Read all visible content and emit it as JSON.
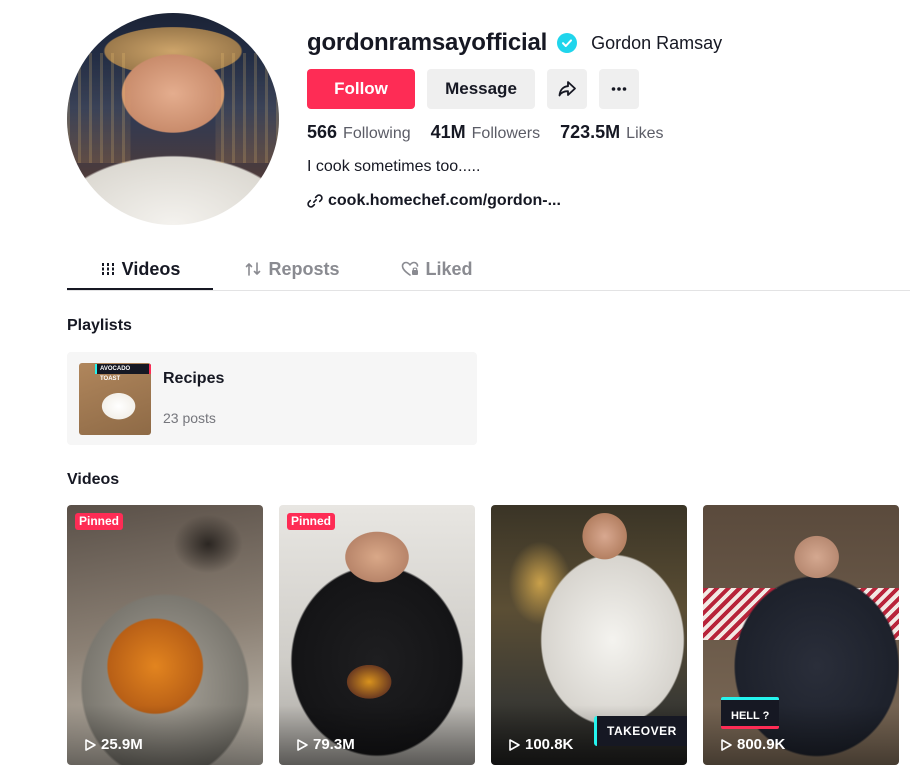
{
  "profile": {
    "username": "gordonramsayofficial",
    "display_name": "Gordon Ramsay",
    "verified": true,
    "follow_label": "Follow",
    "message_label": "Message",
    "stats": [
      {
        "value": "566",
        "label": "Following"
      },
      {
        "value": "41M",
        "label": "Followers"
      },
      {
        "value": "723.5M",
        "label": "Likes"
      }
    ],
    "bio": "I cook sometimes too.....",
    "link": "cook.homechef.com/gordon-..."
  },
  "tabs": [
    {
      "label": "Videos",
      "icon": "grid-icon",
      "active": true
    },
    {
      "label": "Reposts",
      "icon": "repost-icon",
      "active": false
    },
    {
      "label": "Liked",
      "icon": "heart-lock-icon",
      "active": false
    }
  ],
  "playlists": {
    "title": "Playlists",
    "items": [
      {
        "name": "Recipes",
        "count": "23 posts",
        "thumb_tag": "AVOCADO TOAST"
      }
    ]
  },
  "videos": {
    "title": "Videos",
    "items": [
      {
        "badge": "Pinned",
        "views": "25.9M"
      },
      {
        "badge": "Pinned",
        "views": "79.3M"
      },
      {
        "badge": "",
        "views": "100.8K",
        "overlay_text": "TAKEOVER"
      },
      {
        "badge": "",
        "views": "800.9K",
        "overlay_text": "HELL ?"
      }
    ]
  },
  "colors": {
    "accent": "#fe2c55",
    "verified": "#20d5ec",
    "text_primary": "#161823",
    "text_secondary": "#5b5c66"
  }
}
